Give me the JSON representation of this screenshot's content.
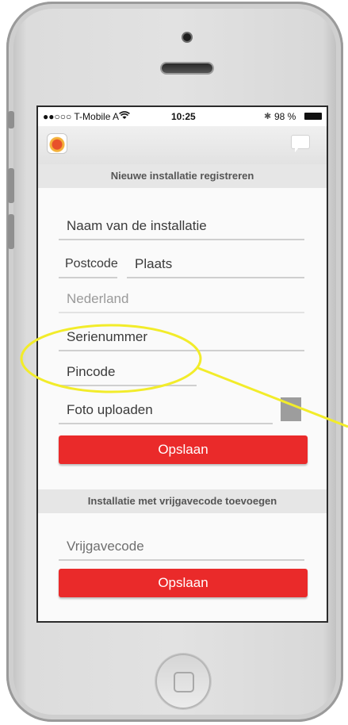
{
  "status_bar": {
    "carrier": "●●○○○ T-Mobile A",
    "time": "10:25",
    "battery": "98 %"
  },
  "registration": {
    "header": "Nieuwe installatie registreren",
    "fields": {
      "installation_name": "Naam van de installatie",
      "postcode": "Postcode",
      "place": "Plaats",
      "country": "Nederland",
      "serial_number": "Serienummer",
      "pincode": "Pincode",
      "photo_upload": "Foto uploaden"
    },
    "save_label": "Opslaan"
  },
  "release_code": {
    "header": "Installatie met vrijgavecode toevoegen",
    "field_placeholder": "Vrijgavecode",
    "save_label": "Opslaan"
  },
  "colors": {
    "accent": "#ea2a2a",
    "annotation": "#f2ec2a"
  },
  "icons": [
    "app-logo-icon",
    "chat-icon",
    "wifi-icon",
    "bluetooth-icon",
    "battery-icon",
    "home-button-icon"
  ]
}
